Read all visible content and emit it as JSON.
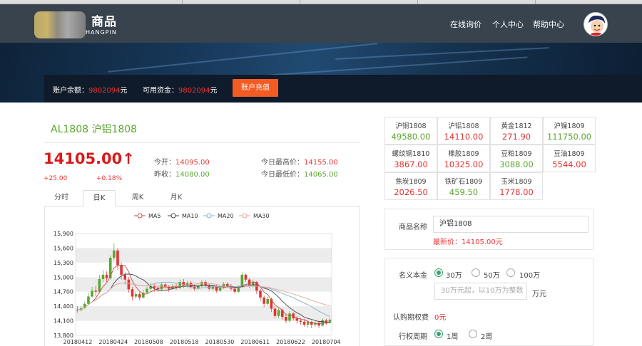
{
  "header": {
    "logo_text": "商品",
    "logo_sub": "HANGPIN",
    "nav": [
      "在线询价",
      "个人中心",
      "帮助中心"
    ]
  },
  "account": {
    "balance_label": "账户余额：",
    "balance_value": "9802094",
    "balance_unit": "元",
    "available_label": "可用资金：",
    "available_value": "9802094",
    "available_unit": "元",
    "recharge_label": "账户充值"
  },
  "product": {
    "title": "AL1808 沪铝1808",
    "price": "14105.00↑",
    "change": "+25.00",
    "change_pct": "+0.18%",
    "open_label": "今开：",
    "open_value": "14095.00",
    "prev_label": "昨收：",
    "prev_value": "14080.00",
    "high_label": "今日最高价：",
    "high_value": "14155.00",
    "low_label": "今日最低价：",
    "low_value": "14065.00"
  },
  "chart_tabs": [
    "分时",
    "日K",
    "周K",
    "月K"
  ],
  "chart_data": {
    "type": "candlestick",
    "legend": [
      "MA5",
      "MA10",
      "MA20",
      "MA30"
    ],
    "ylim": [
      13800,
      15900
    ],
    "yticks": [
      "15,900",
      "15,600",
      "15,300",
      "15,000",
      "14,700",
      "14,400",
      "14,100",
      "13,800"
    ],
    "xticks": [
      "20180412",
      "20180424",
      "20180508",
      "20180518",
      "20180530",
      "20180611",
      "20180622",
      "20180704"
    ],
    "candles": [
      [
        14330,
        14320,
        14400,
        14270
      ],
      [
        14320,
        14360,
        14410,
        14300
      ],
      [
        14360,
        14450,
        14500,
        14340
      ],
      [
        14450,
        14600,
        14680,
        14430
      ],
      [
        14600,
        14720,
        14800,
        14580
      ],
      [
        14720,
        14700,
        14820,
        14600
      ],
      [
        14700,
        14960,
        15050,
        14680
      ],
      [
        14960,
        15050,
        15150,
        14900
      ],
      [
        15050,
        14980,
        15120,
        14900
      ],
      [
        14980,
        15400,
        15450,
        14950
      ],
      [
        15400,
        15550,
        15700,
        15350
      ],
      [
        15550,
        15250,
        15600,
        15150
      ],
      [
        15250,
        15050,
        15300,
        14950
      ],
      [
        15050,
        14950,
        15100,
        14850
      ],
      [
        14950,
        14750,
        15000,
        14680
      ],
      [
        14750,
        14600,
        14800,
        14520
      ],
      [
        14600,
        14650,
        14700,
        14550
      ],
      [
        14650,
        14580,
        14700,
        14520
      ],
      [
        14580,
        14680,
        14740,
        14560
      ],
      [
        14680,
        14760,
        14800,
        14650
      ],
      [
        14760,
        14820,
        14880,
        14720
      ],
      [
        14820,
        14780,
        14860,
        14700
      ],
      [
        14780,
        14750,
        14820,
        14700
      ],
      [
        14750,
        14850,
        14900,
        14720
      ],
      [
        14850,
        14800,
        14880,
        14760
      ],
      [
        14800,
        14760,
        14840,
        14700
      ],
      [
        14760,
        14820,
        14860,
        14740
      ],
      [
        14820,
        14780,
        14880,
        14740
      ],
      [
        14780,
        14900,
        14950,
        14760
      ],
      [
        14900,
        14820,
        14960,
        14780
      ],
      [
        14820,
        14880,
        14920,
        14780
      ],
      [
        14880,
        14800,
        14920,
        14760
      ],
      [
        14800,
        14760,
        14840,
        14720
      ],
      [
        14760,
        14820,
        14860,
        14740
      ],
      [
        14820,
        14900,
        14940,
        14780
      ],
      [
        14900,
        14840,
        14940,
        14800
      ],
      [
        14840,
        14760,
        14880,
        14720
      ],
      [
        14760,
        14800,
        14840,
        14720
      ],
      [
        14800,
        14720,
        14840,
        14680
      ],
      [
        14720,
        14780,
        14820,
        14700
      ],
      [
        14780,
        14860,
        14900,
        14760
      ],
      [
        14860,
        14820,
        14900,
        14780
      ],
      [
        14820,
        14760,
        14860,
        14720
      ],
      [
        14760,
        14700,
        14800,
        14660
      ],
      [
        14700,
        14800,
        14840,
        14680
      ],
      [
        14800,
        15050,
        15100,
        14780
      ],
      [
        15050,
        14950,
        15080,
        14900
      ],
      [
        14950,
        14820,
        14980,
        14780
      ],
      [
        14820,
        14900,
        14950,
        14780
      ],
      [
        14900,
        14720,
        14920,
        14650
      ],
      [
        14720,
        14580,
        14750,
        14500
      ],
      [
        14580,
        14450,
        14620,
        14380
      ],
      [
        14450,
        14550,
        14600,
        14400
      ],
      [
        14550,
        14350,
        14580,
        14280
      ],
      [
        14350,
        14200,
        14400,
        14150
      ],
      [
        14200,
        14320,
        14360,
        14150
      ],
      [
        14320,
        14180,
        14350,
        14120
      ],
      [
        14180,
        14100,
        14230,
        14050
      ],
      [
        14100,
        14250,
        14300,
        14060
      ],
      [
        14250,
        14150,
        14280,
        14100
      ],
      [
        14150,
        14100,
        14200,
        14040
      ],
      [
        14100,
        14080,
        14160,
        14020
      ],
      [
        14080,
        14020,
        14140,
        13980
      ],
      [
        14020,
        14080,
        14120,
        13960
      ],
      [
        14080,
        14020,
        14100,
        13950
      ],
      [
        14020,
        14060,
        14100,
        13980
      ],
      [
        14060,
        14000,
        14100,
        13950
      ],
      [
        14000,
        14110,
        14150,
        13980
      ],
      [
        14110,
        14060,
        14140,
        14020
      ],
      [
        14060,
        14120,
        14160,
        14040
      ]
    ]
  },
  "quotes": [
    {
      "name": "沪铜1808",
      "price": "49580.00",
      "color": "#5aa630"
    },
    {
      "name": "沪铝1808",
      "price": "14110.00",
      "color": "#e33333"
    },
    {
      "name": "黄金1812",
      "price": "271.90",
      "color": "#e33333"
    },
    {
      "name": "沪镍1809",
      "price": "111750.00",
      "color": "#5aa630"
    },
    {
      "name": "螺纹钢1810",
      "price": "3867.00",
      "color": "#e33333"
    },
    {
      "name": "橡胶1809",
      "price": "10325.00",
      "color": "#e33333"
    },
    {
      "name": "豆粕1809",
      "price": "3088.00",
      "color": "#5aa630"
    },
    {
      "name": "豆油1809",
      "price": "5544.00",
      "color": "#e33333"
    },
    {
      "name": "焦炭1809",
      "price": "2026.50",
      "color": "#e33333"
    },
    {
      "name": "铁矿石1809",
      "price": "459.50",
      "color": "#5aa630"
    },
    {
      "name": "玉米1809",
      "price": "1778.00",
      "color": "#e33333"
    }
  ],
  "order": {
    "product_label": "商品名称",
    "product_value": "沪铝1808",
    "latest_label": "最新价：",
    "latest_value": "14105.00元",
    "notional_label": "名义本金",
    "notional_options": [
      "30万",
      "50万",
      "100万"
    ],
    "notional_selected": "30万",
    "custom_placeholder": "30万元起，以10万为整数",
    "custom_unit": "万元",
    "premium_label": "认购期权费",
    "premium_value": "0元",
    "period_label": "行权周期",
    "period_options": [
      "1周",
      "2周"
    ],
    "period_selected": "1周"
  },
  "colors": {
    "up": "#e33333",
    "down": "#5aa630",
    "accent": "#f35b23",
    "header": "#39434e"
  }
}
